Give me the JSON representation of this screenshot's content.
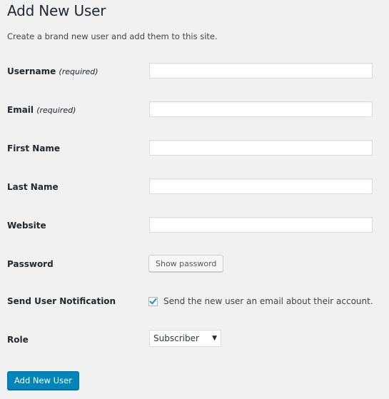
{
  "page": {
    "title": "Add New User",
    "description": "Create a brand new user and add them to this site."
  },
  "fields": [
    {
      "label": "Username",
      "note": "(required)",
      "value": ""
    },
    {
      "label": "Email",
      "note": "(required)",
      "value": ""
    },
    {
      "label": "First Name",
      "note": "",
      "value": ""
    },
    {
      "label": "Last Name",
      "note": "",
      "value": ""
    },
    {
      "label": "Website",
      "note": "",
      "value": ""
    }
  ],
  "password": {
    "label": "Password",
    "button_label": "Show password"
  },
  "notification": {
    "label": "Send User Notification",
    "checkbox_label": "Send the new user an email about their account.",
    "checked": true,
    "check_color": "#1e8cbe"
  },
  "role": {
    "label": "Role",
    "selected": "Subscriber"
  },
  "submit": {
    "label": "Add New User",
    "color": "#0085ba"
  }
}
